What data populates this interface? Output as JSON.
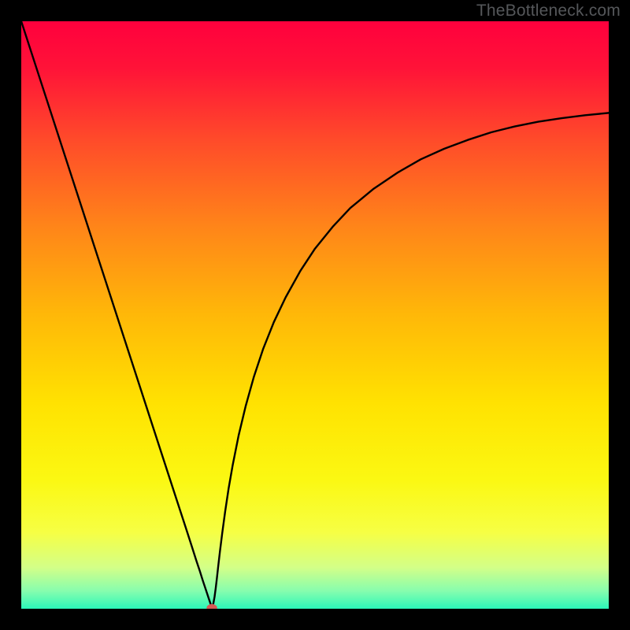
{
  "watermark": "TheBottleneck.com",
  "chart_data": {
    "type": "line",
    "title": "",
    "xlabel": "",
    "ylabel": "",
    "xlim": [
      0,
      100
    ],
    "ylim": [
      0,
      100
    ],
    "grid": false,
    "legend": null,
    "background": {
      "type": "vertical-gradient",
      "stops": [
        {
          "pos": 0.0,
          "color": "#ff003d"
        },
        {
          "pos": 0.08,
          "color": "#ff1338"
        },
        {
          "pos": 0.2,
          "color": "#ff4a2a"
        },
        {
          "pos": 0.35,
          "color": "#ff8519"
        },
        {
          "pos": 0.5,
          "color": "#ffb808"
        },
        {
          "pos": 0.65,
          "color": "#ffe201"
        },
        {
          "pos": 0.78,
          "color": "#fbf812"
        },
        {
          "pos": 0.87,
          "color": "#f6ff44"
        },
        {
          "pos": 0.93,
          "color": "#d3ff88"
        },
        {
          "pos": 0.97,
          "color": "#86fdae"
        },
        {
          "pos": 1.0,
          "color": "#2bf7b9"
        }
      ]
    },
    "series": [
      {
        "name": "bottleneck-curve",
        "color": "#000000",
        "x": [
          0.0,
          2.5,
          5.0,
          7.5,
          10.0,
          12.5,
          15.0,
          17.5,
          20.0,
          22.5,
          25.0,
          26.5,
          28.0,
          29.0,
          29.8,
          30.4,
          30.9,
          31.3,
          31.6,
          31.9,
          32.2,
          32.45,
          32.7,
          32.9,
          33.1,
          33.3,
          33.5,
          33.8,
          34.2,
          34.7,
          35.3,
          36.0,
          37.0,
          38.2,
          39.6,
          41.2,
          43.0,
          45.0,
          47.5,
          50.0,
          53.0,
          56.0,
          60.0,
          64.0,
          68.0,
          72.0,
          76.0,
          80.0,
          84.0,
          88.0,
          92.0,
          96.0,
          100.0
        ],
        "y": [
          100.0,
          92.3,
          84.6,
          76.9,
          69.2,
          61.5,
          53.8,
          46.1,
          38.4,
          30.7,
          23.0,
          18.4,
          13.8,
          10.7,
          8.2,
          6.4,
          4.8,
          3.6,
          2.7,
          1.8,
          0.9,
          0.15,
          0.9,
          2.0,
          3.5,
          5.2,
          7.0,
          9.6,
          12.8,
          16.5,
          20.5,
          24.5,
          29.5,
          34.5,
          39.5,
          44.3,
          48.8,
          53.0,
          57.5,
          61.3,
          65.0,
          68.2,
          71.5,
          74.2,
          76.5,
          78.3,
          79.8,
          81.1,
          82.1,
          82.9,
          83.5,
          84.0,
          84.4
        ]
      }
    ],
    "marker": {
      "name": "optimal-point",
      "x": 32.45,
      "y": 0.15,
      "color": "#d65a55",
      "rx": 0.9,
      "ry": 0.65
    }
  }
}
